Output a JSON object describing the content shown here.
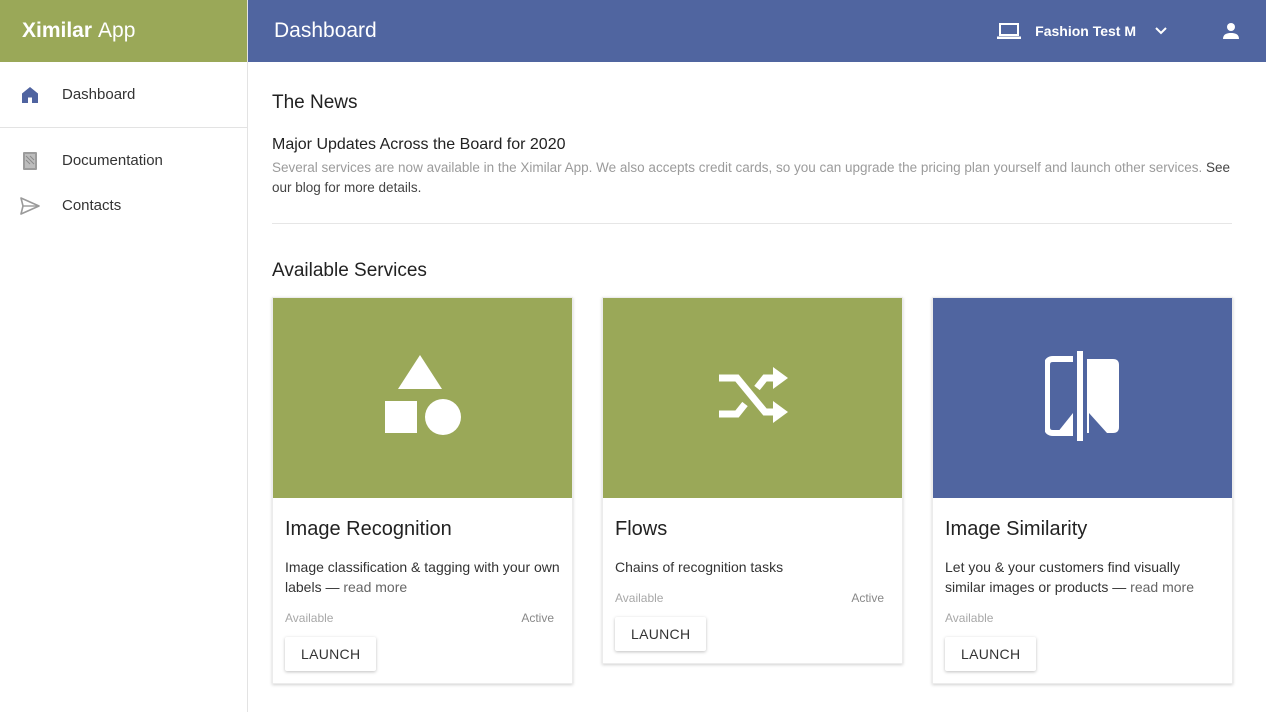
{
  "colors": {
    "brand": "#9aa858",
    "topbar": "#5065a0",
    "card_green": "#9aa858",
    "card_blue": "#5065a0"
  },
  "brand": {
    "bold": "Ximilar",
    "light": "App"
  },
  "sidebar": {
    "items": [
      {
        "label": "Dashboard",
        "icon": "home-icon"
      },
      {
        "label": "Documentation",
        "icon": "book-icon"
      },
      {
        "label": "Contacts",
        "icon": "send-icon"
      }
    ]
  },
  "topbar": {
    "title": "Dashboard",
    "account_name": "Fashion Test M",
    "icons": [
      "laptop-icon",
      "chevron-down-icon",
      "user-icon"
    ]
  },
  "news": {
    "heading": "The News",
    "title": "Major Updates Across the Board for 2020",
    "body": "Several services are now available in the Ximilar App. We also accepts credit cards, so you can upgrade the pricing plan yourself and launch other services.",
    "link": "See our blog for more details."
  },
  "services": {
    "heading": "Available Services",
    "cards": [
      {
        "title": "Image Recognition",
        "desc": "Image classification & tagging with your own labels —",
        "more": "read more",
        "available": "Available",
        "active": "Active",
        "button": "LAUNCH",
        "icon": "shapes-icon"
      },
      {
        "title": "Flows",
        "desc": "Chains of recognition tasks",
        "more": "",
        "available": "Available",
        "active": "Active",
        "button": "LAUNCH",
        "icon": "shuffle-icon"
      },
      {
        "title": "Image Similarity",
        "desc": "Let you & your customers find visually similar images or products —",
        "more": "read more",
        "available": "Available",
        "active": "",
        "button": "LAUNCH",
        "icon": "compare-icon"
      }
    ]
  }
}
